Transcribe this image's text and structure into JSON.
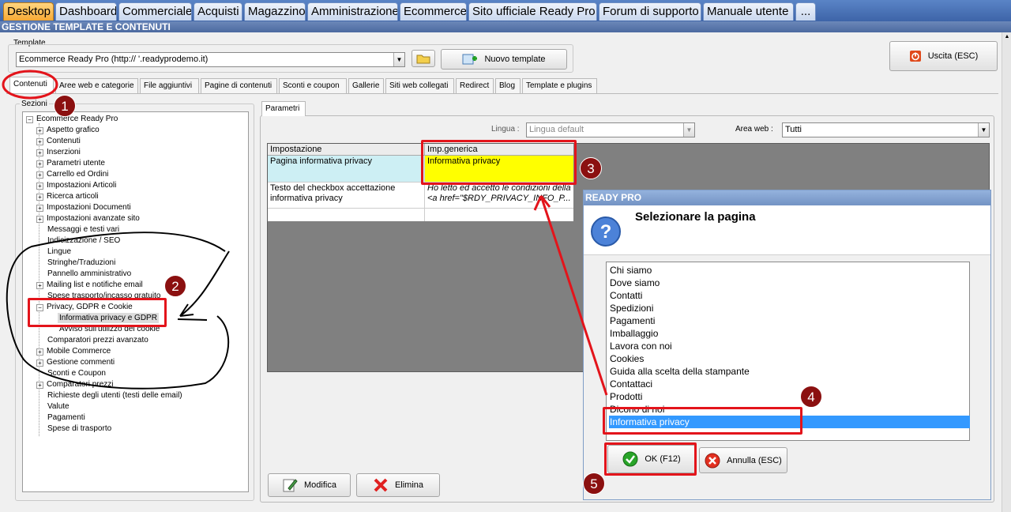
{
  "top_tabs": [
    "Desktop",
    "Dashboard",
    "Commerciale",
    "Acquisti",
    "Magazzino",
    "Amministrazione",
    "Ecommerce",
    "Sito ufficiale Ready Pro",
    "Forum di supporto",
    "Manuale utente",
    "..."
  ],
  "app_title": "GESTIONE TEMPLATE E CONTENUTI",
  "template": {
    "label": "Template",
    "selected": "Ecommerce Ready Pro (http://      '.readyprodemo.it)",
    "new_button": "Nuovo template"
  },
  "exit_button": "Uscita (ESC)",
  "section_tabs": [
    "Contenuti",
    "Aree web e categorie",
    "File aggiuntivi",
    "Pagine di contenuti",
    "Sconti e coupon",
    "Gallerie",
    "Siti web collegati",
    "Redirect",
    "Blog",
    "Template e plugins"
  ],
  "sections_label": "Sezioni",
  "tree": {
    "root": "Ecommerce Ready Pro",
    "items": [
      "Aspetto grafico",
      "Contenuti",
      "Inserzioni",
      "Parametri utente",
      "Carrello ed Ordini",
      "Impostazioni Articoli",
      "Ricerca articoli",
      "Impostazioni Documenti",
      "Impostazioni avanzate sito",
      "Messaggi e testi vari",
      "Indicizzazione / SEO",
      "Lingue",
      "Stringhe/Traduzioni",
      "Pannello amministrativo",
      "Mailing list e notifiche email",
      "Spese trasporto/incasso gratuito",
      "Privacy, GDPR e Cookie",
      "Informativa privacy e GDPR",
      "Avviso sull'utilizzo dei cookie",
      "Comparatori prezzi avanzato",
      "Mobile Commerce",
      "Gestione commenti",
      "Sconti e Coupon",
      "Comparatori prezzi",
      "Richieste degli utenti (testi delle email)",
      "Valute",
      "Pagamenti",
      "Spese di trasporto"
    ]
  },
  "params_tab": "Parametri",
  "lingua": {
    "label": "Lingua :",
    "value": "Lingua default"
  },
  "area_web": {
    "label": "Area web :",
    "value": "Tutti"
  },
  "grid": {
    "headers": [
      "Impostazione",
      "Imp.generica"
    ],
    "rows": [
      [
        "Pagina informativa privacy",
        "Informativa privacy"
      ],
      [
        "Testo del checkbox accettazione informativa privacy",
        "Ho letto ed accetto le condizioni della <a href=\"$RDY_PRIVACY_INFO_P..."
      ]
    ]
  },
  "modifica_button": "Modifica",
  "elimina_button": "Elimina",
  "dialog": {
    "title": "READY PRO",
    "heading": "Selezionare la pagina",
    "items": [
      "Chi siamo",
      "Dove siamo",
      "Contatti",
      "Spedizioni",
      "Pagamenti",
      "Imballaggio",
      "Lavora con noi",
      "Cookies",
      "Guida alla scelta della stampante",
      "Contattaci",
      "Prodotti",
      "Dicono di noi",
      "Informativa privacy"
    ],
    "selected_index": 12,
    "ok_button": "OK (F12)",
    "cancel_button": "Annulla (ESC)"
  },
  "badges": [
    "1",
    "2",
    "3",
    "4",
    "5"
  ],
  "colors": {
    "accent_red": "#e3141b",
    "selection_blue": "#3399ff",
    "highlight_yellow": "#ffff00"
  }
}
